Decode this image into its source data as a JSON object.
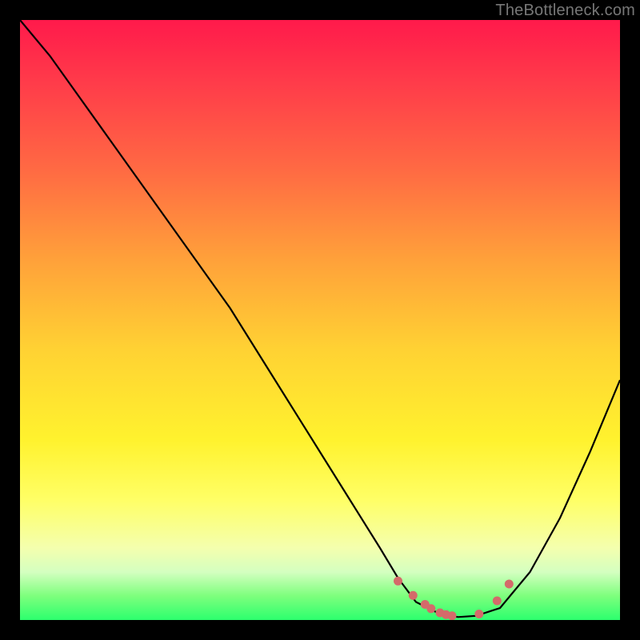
{
  "watermark": "TheBottleneck.com",
  "colors": {
    "bg": "#000000",
    "gradient_top": "#ff1a4b",
    "gradient_bottom": "#2cff6e",
    "curve": "#000000",
    "marker": "#d46a6a"
  },
  "chart_data": {
    "type": "line",
    "title": "",
    "xlabel": "",
    "ylabel": "",
    "xlim": [
      0,
      100
    ],
    "ylim": [
      0,
      100
    ],
    "series": [
      {
        "name": "bottleneck-curve",
        "x": [
          0,
          5,
          10,
          15,
          20,
          25,
          30,
          35,
          40,
          45,
          50,
          55,
          60,
          63,
          66,
          70,
          73,
          76,
          80,
          85,
          90,
          95,
          100
        ],
        "values": [
          100,
          94,
          87,
          80,
          73,
          66,
          59,
          52,
          44,
          36,
          28,
          20,
          12,
          7,
          3,
          1,
          0.5,
          0.7,
          2,
          8,
          17,
          28,
          40
        ]
      }
    ],
    "markers": [
      {
        "x": 63,
        "y": 6.5
      },
      {
        "x": 65.5,
        "y": 4.1
      },
      {
        "x": 67.5,
        "y": 2.6
      },
      {
        "x": 68.5,
        "y": 1.9
      },
      {
        "x": 70,
        "y": 1.2
      },
      {
        "x": 71,
        "y": 0.9
      },
      {
        "x": 72,
        "y": 0.7
      },
      {
        "x": 76.5,
        "y": 1.0
      },
      {
        "x": 79.5,
        "y": 3.2
      },
      {
        "x": 81.5,
        "y": 6.0
      }
    ]
  }
}
